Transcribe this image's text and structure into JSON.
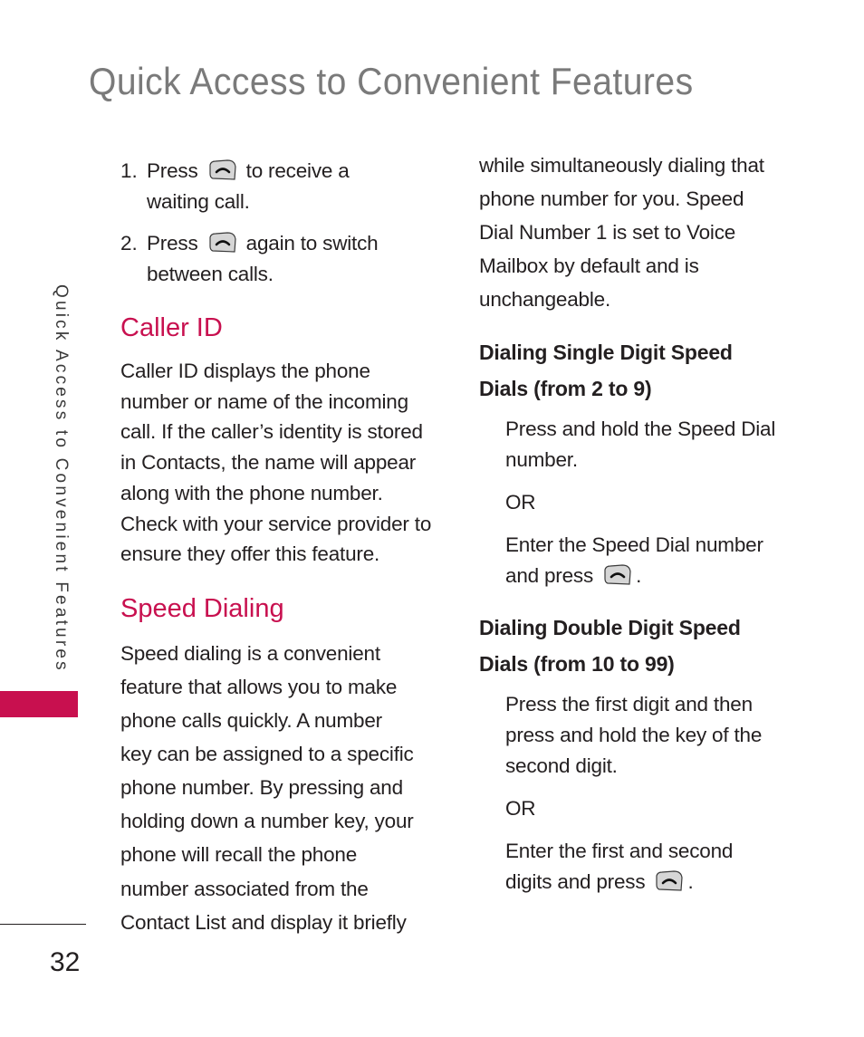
{
  "page": {
    "title": "Quick Access to Convenient Features",
    "side_tab": "Quick Access to Convenient Features",
    "page_number": "32",
    "accent_color": "#c8104f"
  },
  "left_column": {
    "steps": [
      {
        "number": "1.",
        "before_icon": "Press",
        "icon": "send-key-icon",
        "after_icon": "to receive a",
        "continuation": "waiting call."
      },
      {
        "number": "2.",
        "before_icon": "Press",
        "icon": "send-key-icon",
        "after_icon": "again to switch",
        "continuation": "between calls."
      }
    ],
    "caller_id": {
      "heading": "Caller ID",
      "lines": [
        "Caller ID displays the phone",
        "number or name of the incoming",
        "call. If the caller’s identity is stored",
        "in Contacts, the name will appear",
        "along with the phone number.",
        "Check with your service provider to",
        "ensure they offer this feature."
      ]
    },
    "speed_dialing": {
      "heading": "Speed Dialing",
      "lines": [
        "Speed dialing is a convenient",
        "feature that allows you to make",
        "phone calls quickly. A number",
        "key can be assigned to a specific",
        "phone number. By pressing and",
        "holding down a number key, your",
        "phone will recall the phone",
        "number associated from the",
        "Contact List and display it briefly"
      ]
    }
  },
  "right_column": {
    "intro_lines": [
      "while simultaneously dialing that",
      "phone number for you. Speed",
      "Dial Number 1 is set to Voice",
      "Mailbox by default and is",
      "unchangeable."
    ],
    "single_digit": {
      "heading_lines": [
        "Dialing Single Digit Speed",
        "Dials (from 2 to 9)"
      ],
      "option1_lines": [
        "Press and hold the Speed Dial",
        "number."
      ],
      "or": "OR",
      "option2_lines": [
        "Enter the Speed Dial number"
      ],
      "option2_last_before_icon": "and press",
      "option2_last_after_icon": ".",
      "icon": "send-key-icon"
    },
    "double_digit": {
      "heading_lines": [
        "Dialing Double Digit Speed",
        "Dials (from 10 to 99)"
      ],
      "option1_lines": [
        "Press the first digit and then",
        "press and hold the key of the",
        "second digit."
      ],
      "or": "OR",
      "option2_lines": [
        "Enter the first and second"
      ],
      "option2_last_before_icon": "digits and press",
      "option2_last_after_icon": ".",
      "icon": "send-key-icon"
    }
  }
}
